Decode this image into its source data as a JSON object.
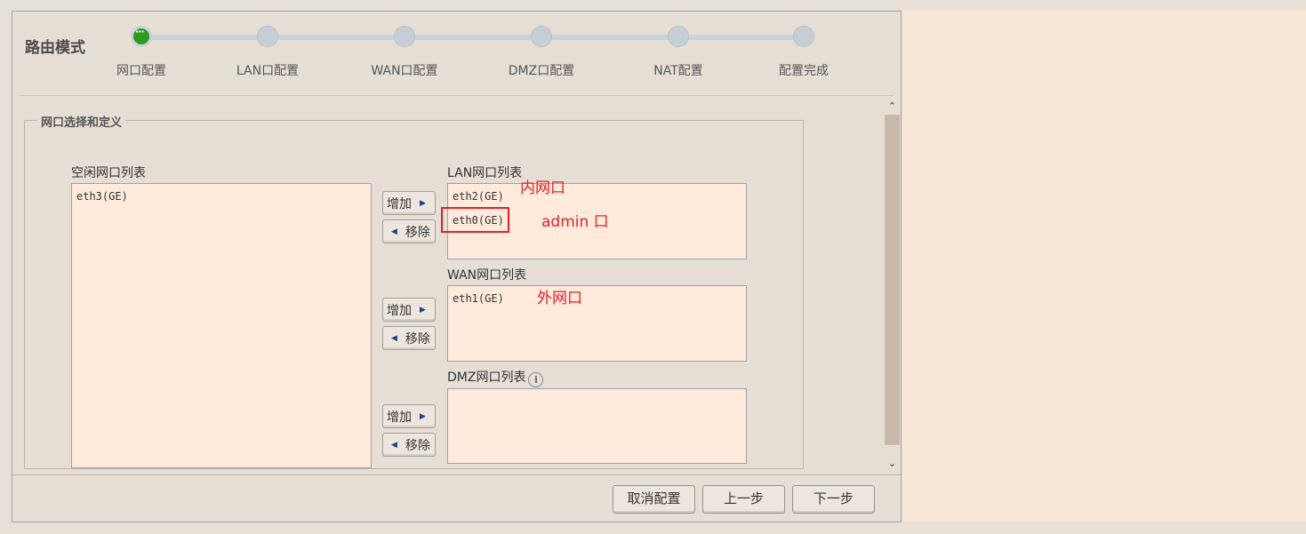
{
  "page": {
    "mode_title": "路由模式"
  },
  "steps": [
    {
      "label": "网口配置",
      "active": true
    },
    {
      "label": "LAN口配置",
      "active": false
    },
    {
      "label": "WAN口配置",
      "active": false
    },
    {
      "label": "DMZ口配置",
      "active": false
    },
    {
      "label": "NAT配置",
      "active": false
    },
    {
      "label": "配置完成",
      "active": false
    }
  ],
  "section": {
    "legend": "网口选择和定义",
    "idle_list": {
      "label": "空闲网口列表",
      "items": [
        "eth3(GE)"
      ]
    },
    "lan_list": {
      "label": "LAN网口列表",
      "items": [
        "eth2(GE)",
        "eth0(GE)"
      ]
    },
    "wan_list": {
      "label": "WAN网口列表",
      "items": [
        "eth1(GE)"
      ]
    },
    "dmz_list": {
      "label": "DMZ网口列表",
      "items": [],
      "info_icon": "info-icon"
    },
    "add_label": "增加",
    "remove_label": "移除"
  },
  "annotations": {
    "lan_note": "内网口",
    "admin_note": "admin 口",
    "wan_note": "外网口",
    "color": "#e0222a"
  },
  "footer": {
    "cancel_label": "取消配置",
    "prev_label": "上一步",
    "next_label": "下一步"
  },
  "colors": {
    "active_step": "#2e9a1f",
    "listbox_bg": "#ffeadb",
    "panel_bg": "#e7dfd5"
  }
}
